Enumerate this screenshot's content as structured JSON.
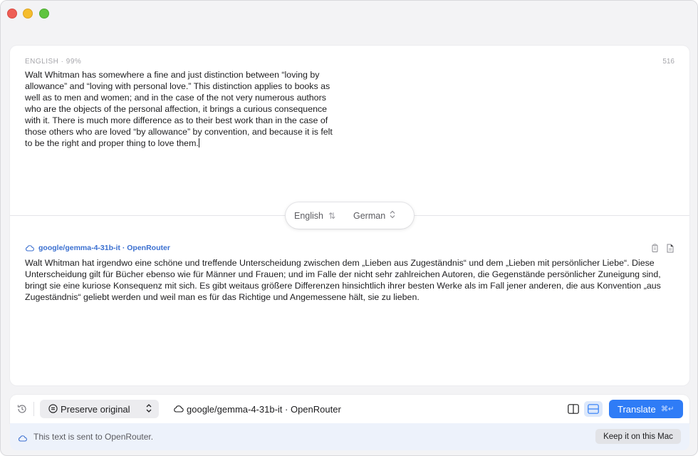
{
  "source": {
    "meta": "ENGLISH · 99%",
    "char_count": "516",
    "text": "Walt Whitman has somewhere a fine and just distinction between “loving by allowance” and “loving with personal love.” This distinction applies to books as well as to men and women; and in the case of the not very numerous authors who are the objects of the personal affection, it brings a curious consequence with it. There is much more difference as to their best work than in the case of those others who are loved “by allowance” by convention, and because it is felt to be the right and proper thing to love them."
  },
  "languages": {
    "source": "English",
    "target": "German",
    "swap_icon": "swap-arrows-icon",
    "target_chevron": "updown-chevron-icon"
  },
  "result": {
    "model_label": "google/gemma-4-31b-it · OpenRouter",
    "text": "Walt Whitman hat irgendwo eine schöne und treffende Unterscheidung zwischen dem „Lieben aus Zugeständnis“ und dem „Lieben mit persönlicher Liebe“. Diese Unterscheidung gilt für Bücher ebenso wie für Männer und Frauen; und im Falle der nicht sehr zahlreichen Autoren, die Gegenstände persönlicher Zuneigung sind, bringt sie eine kuriose Konsequenz mit sich. Es gibt weitaus größere Differenzen hinsichtlich ihrer besten Werke als im Fall jener anderen, die aus Konvention „aus Zugeständnis“ geliebt werden und weil man es für das Richtige und Angemessene hält, sie zu lieben.",
    "icons": [
      "cloud-icon",
      "copy-icon",
      "document-icon"
    ]
  },
  "toolbar": {
    "preserve_label": "Preserve original",
    "model_picker": "google/gemma-4-31b-it · OpenRouter",
    "translate_label": "Translate",
    "translate_shortcut": "⌘↵"
  },
  "notice": {
    "text": "This text is sent to OpenRouter.",
    "keep_button": "Keep it on this Mac"
  },
  "colors": {
    "accent": "#2f7cf6",
    "model_link": "#3a6fd0",
    "notice_bg": "#edf2fb"
  }
}
